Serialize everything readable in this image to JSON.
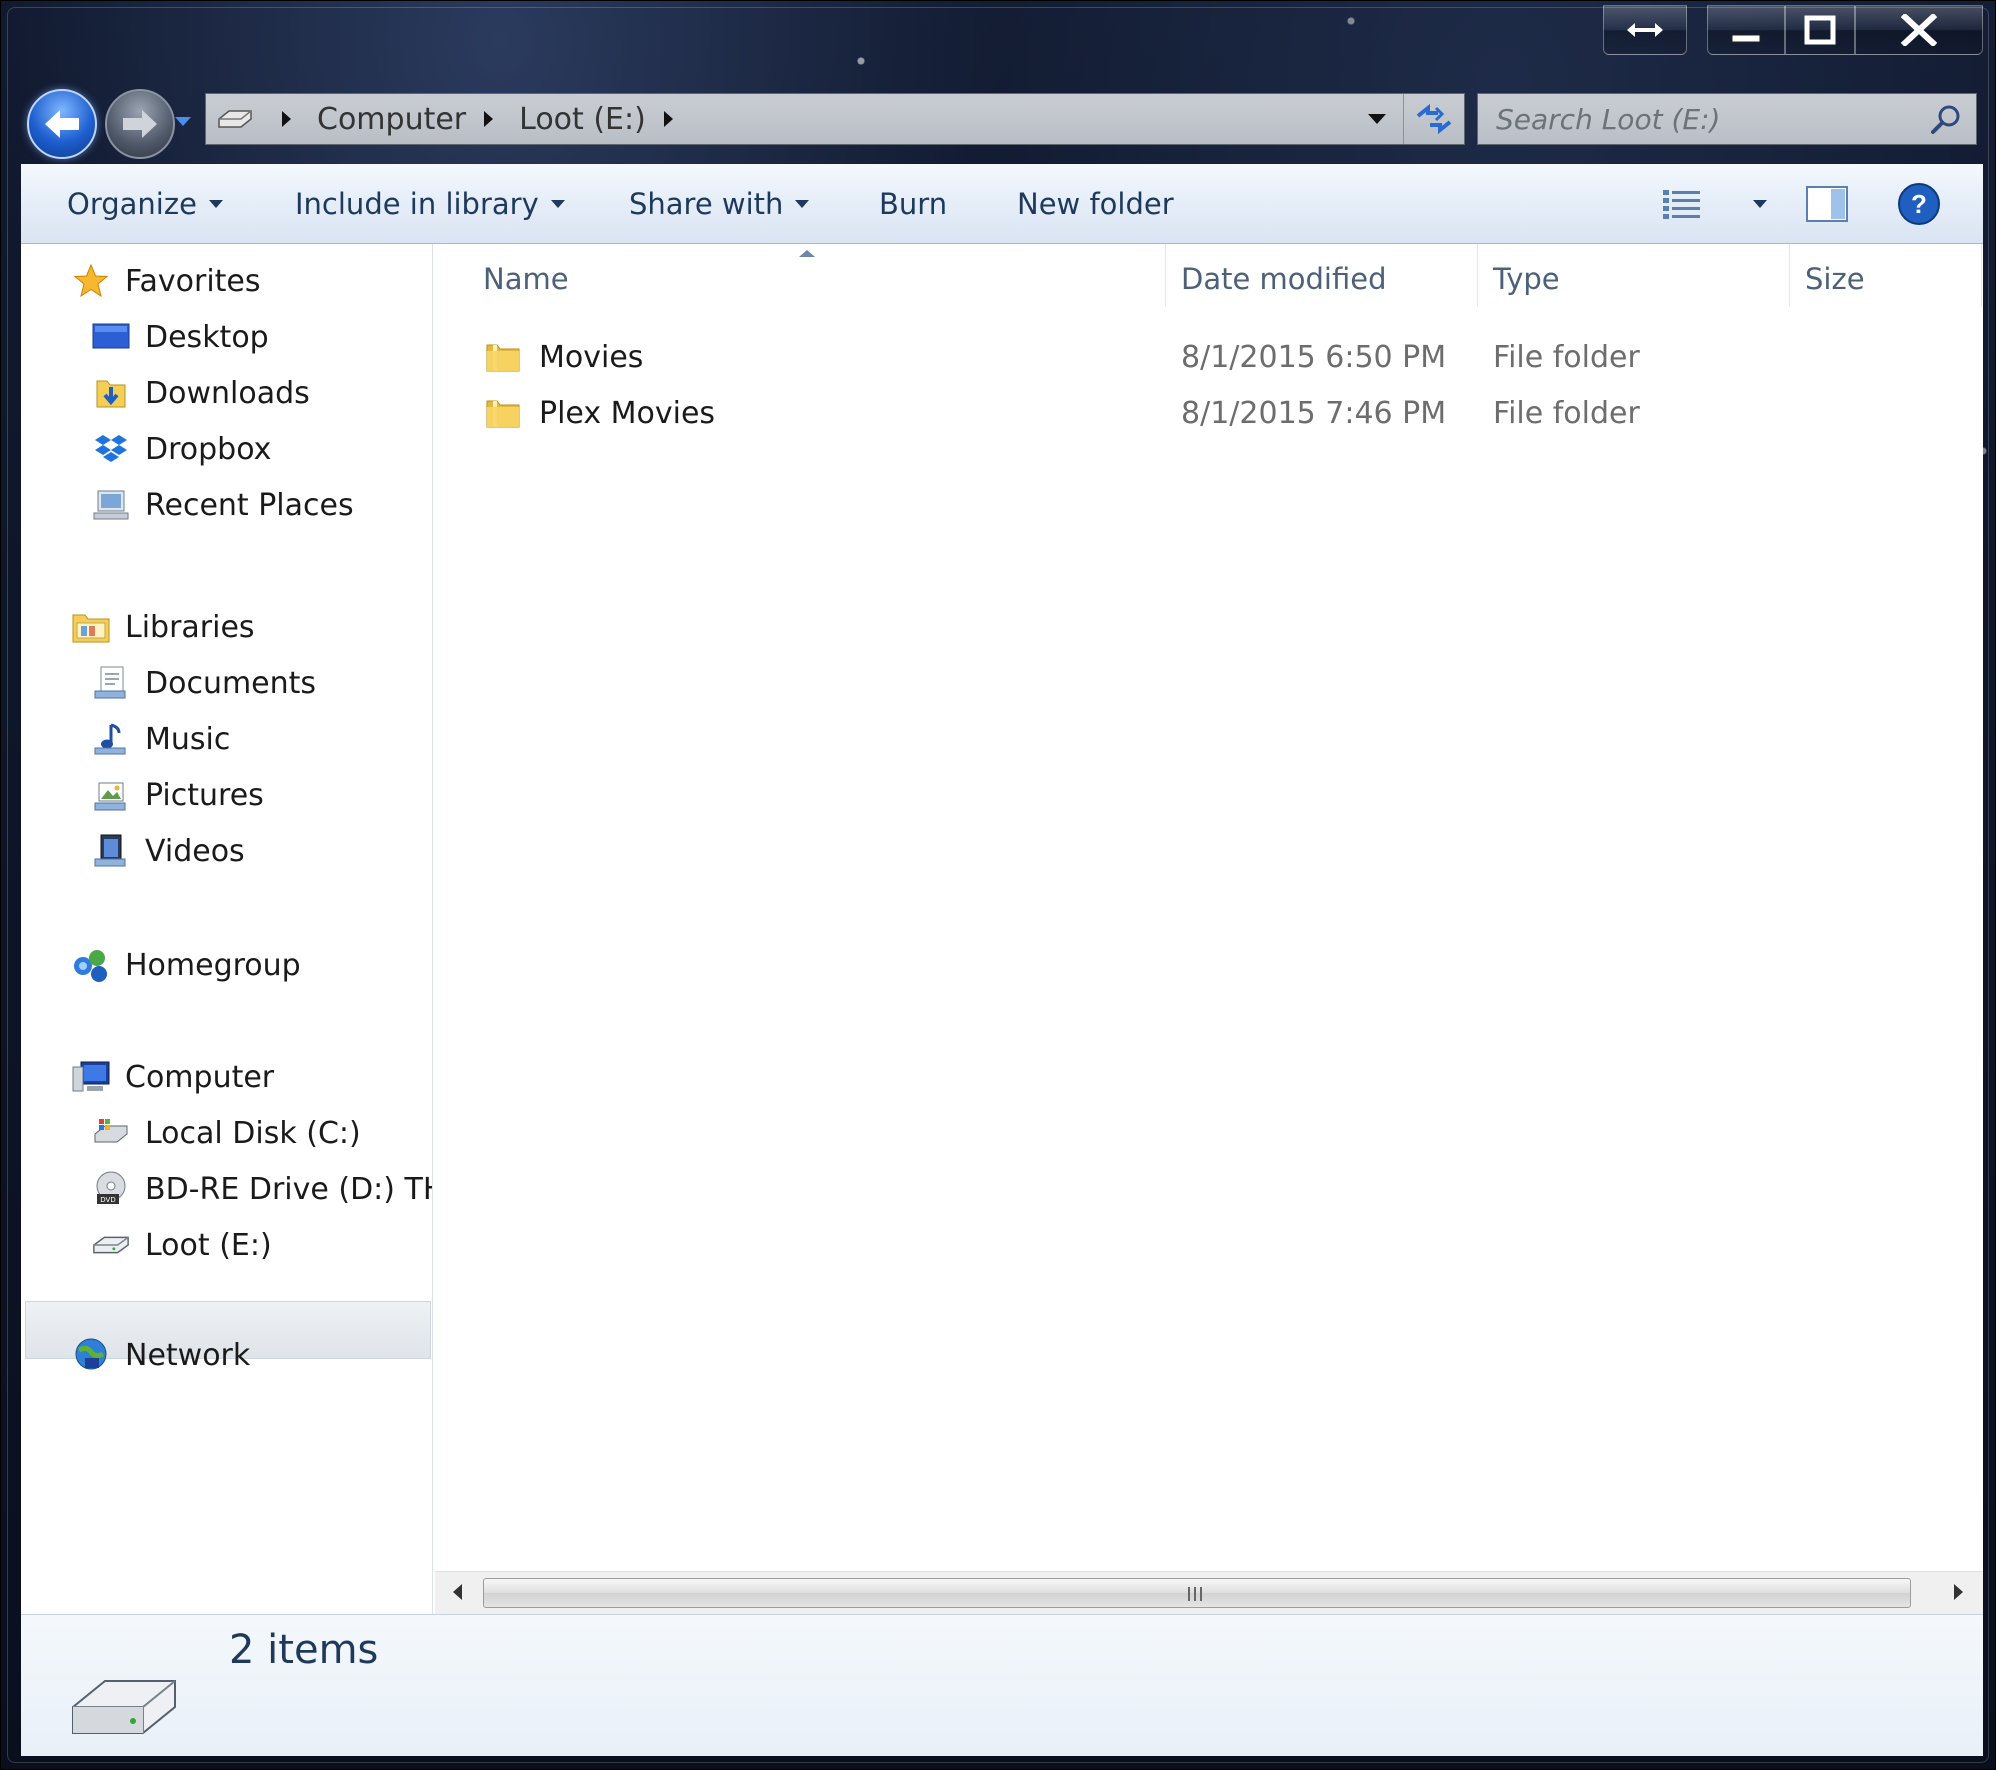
{
  "window": {
    "caption_buttons": [
      "snap",
      "minimize",
      "maximize",
      "close"
    ]
  },
  "address": {
    "crumbs": [
      "Computer",
      "Loot (E:)"
    ]
  },
  "search": {
    "placeholder": "Search Loot (E:)"
  },
  "toolbar": {
    "organize": "Organize",
    "include_in_library": "Include in library",
    "share_with": "Share with",
    "burn": "Burn",
    "new_folder": "New folder"
  },
  "nav": {
    "favorites": {
      "label": "Favorites",
      "items": [
        "Desktop",
        "Downloads",
        "Dropbox",
        "Recent Places"
      ]
    },
    "libraries": {
      "label": "Libraries",
      "items": [
        "Documents",
        "Music",
        "Pictures",
        "Videos"
      ]
    },
    "homegroup": {
      "label": "Homegroup"
    },
    "computer": {
      "label": "Computer",
      "items": [
        "Local Disk (C:)",
        "BD-RE Drive (D:) THE",
        "Loot (E:)"
      ],
      "selected": "Loot (E:)"
    },
    "network": {
      "label": "Network"
    }
  },
  "columns": {
    "name": "Name",
    "date_modified": "Date modified",
    "type": "Type",
    "size": "Size"
  },
  "files": [
    {
      "name": "Movies",
      "date": "8/1/2015 6:50 PM",
      "type": "File folder",
      "size": ""
    },
    {
      "name": "Plex Movies",
      "date": "8/1/2015 7:46 PM",
      "type": "File folder",
      "size": ""
    }
  ],
  "details": {
    "count": "2 items"
  },
  "colors": {
    "toolbar_text": "#1e395b",
    "column_header_text": "#4c607a",
    "meta_text": "#6d6d6d",
    "back_button": "#1e5fcf"
  }
}
